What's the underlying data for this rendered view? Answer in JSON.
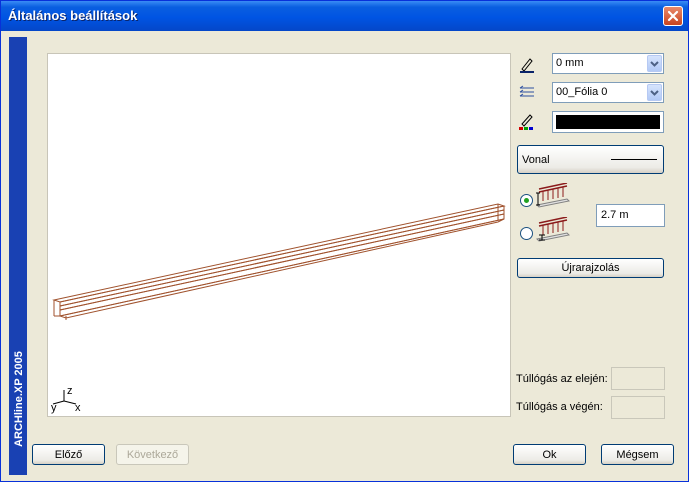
{
  "window": {
    "title": "Általános beállítások"
  },
  "side_banner": {
    "text": "ARCHline.XP 2005"
  },
  "preview": {
    "axis_y": "y",
    "axis_z": "z",
    "axis_x": "x"
  },
  "properties": {
    "line_width": {
      "value": "0 mm",
      "icon": "pen-width-icon"
    },
    "layer": {
      "value": "00_Fólia 0",
      "icon": "layers-icon"
    },
    "color": {
      "value": "#000000",
      "icon": "pen-color-icon"
    },
    "line_type": {
      "label": "Vonal"
    }
  },
  "railing_mode": {
    "options": [
      {
        "icon": "railing-height-icon",
        "selected": true
      },
      {
        "icon": "railing-base-icon",
        "selected": false
      }
    ],
    "height_value": "2.7 m",
    "redraw_label": "Újrarajzolás"
  },
  "overhang": {
    "start_label": "Túllógás az elején:",
    "start_value": "",
    "end_label": "Túllógás a végén:",
    "end_value": ""
  },
  "footer": {
    "prev_label": "Előző",
    "next_label": "Következő",
    "ok_label": "Ok",
    "cancel_label": "Mégsem"
  }
}
